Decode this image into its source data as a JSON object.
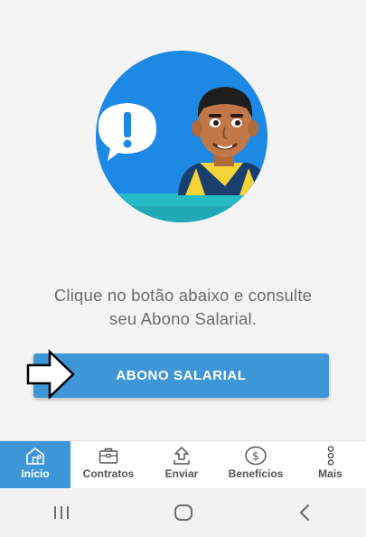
{
  "message": {
    "line1": "Clique no botão abaixo e consulte",
    "line2": "seu Abono Salarial."
  },
  "cta": {
    "label": "ABONO SALARIAL"
  },
  "bottom_nav": {
    "items": [
      {
        "label": "Início",
        "icon": "home-icon",
        "active": true
      },
      {
        "label": "Contratos",
        "icon": "briefcase-icon",
        "active": false
      },
      {
        "label": "Enviar",
        "icon": "upload-icon",
        "active": false
      },
      {
        "label": "Benefícios",
        "icon": "dollar-coin-icon",
        "active": false
      },
      {
        "label": "Mais",
        "icon": "more-vertical-icon",
        "active": false
      }
    ]
  },
  "system_nav": {
    "buttons": [
      "recent-apps-icon",
      "home-button-icon",
      "back-icon"
    ]
  },
  "colors": {
    "accent": "#3e96d6",
    "illustration_bg": "#1e88e5",
    "text_muted": "#6b6b6b"
  }
}
